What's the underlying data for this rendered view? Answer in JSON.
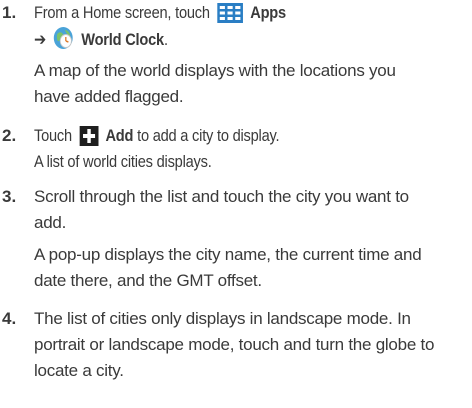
{
  "steps": [
    {
      "number": "1.",
      "line1_pre": "From a Home screen, touch",
      "apps_icon": "apps-grid-icon",
      "apps_label": "Apps",
      "arrow": "➔",
      "worldclock_icon": "world-clock-icon",
      "worldclock_label": "World Clock",
      "worldclock_end": ".",
      "desc_line1": "A map of the world displays with the locations you",
      "desc_line2": "have added flagged."
    },
    {
      "number": "2.",
      "pre": "Touch",
      "add_icon": "plus-icon",
      "add_label": "Add",
      "post": "to add a city to display.",
      "desc_line1": "A list of world cities displays."
    },
    {
      "number": "3.",
      "line1": "Scroll through the list and touch the city you want to",
      "line2": "add.",
      "desc_line1": "A pop-up displays the city name, the current time and",
      "desc_line2": "date there, and the GMT offset."
    },
    {
      "number": "4.",
      "line1": "The list of cities only displays in landscape mode. In",
      "line2": "portrait or landscape mode, touch and turn the globe to",
      "line3": "locate a city."
    }
  ],
  "colors": {
    "text": "#3a3a3a",
    "apps_icon_blue": "#2a7ec4",
    "plus_icon_dark": "#1f1f1f"
  }
}
